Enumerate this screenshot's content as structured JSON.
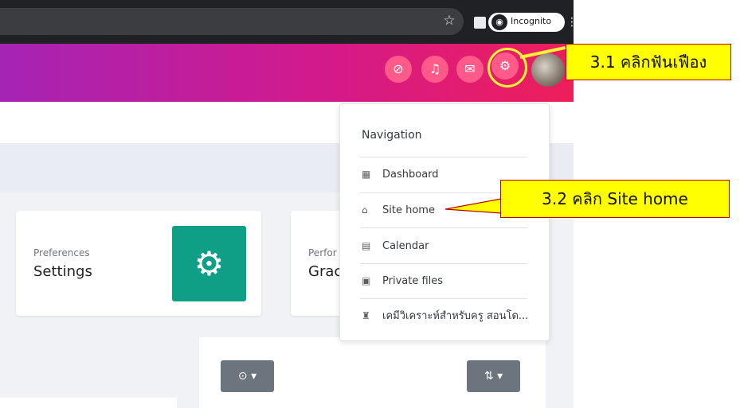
{
  "browser": {
    "incognito_label": "Incognito",
    "star_icon": "star-icon",
    "tab_icon": "sidepanel-icon"
  },
  "header": {
    "buttons": [
      "hide-icon",
      "bell-icon",
      "chat-icon",
      "gear-icon"
    ],
    "gradient_colors": [
      "#a524b4",
      "#d21a8c",
      "#ee1e5a"
    ]
  },
  "annotations": {
    "step1": "3.1 คลิกฟันเฟือง",
    "step2": "3.2 คลิก Site home",
    "highlight_color": "#ffff00",
    "border_color": "#c00000"
  },
  "cards": {
    "preferences": {
      "label": "Preferences",
      "title": "Settings",
      "tile_color": "#0f9f86"
    },
    "performance": {
      "label": "Perfor",
      "title": "Grac"
    }
  },
  "navigation": {
    "heading": "Navigation",
    "items": [
      {
        "icon": "dashboard-icon",
        "label": "Dashboard"
      },
      {
        "icon": "home-icon",
        "label": "Site home"
      },
      {
        "icon": "calendar-icon",
        "label": "Calendar"
      },
      {
        "icon": "file-icon",
        "label": "Private files"
      },
      {
        "icon": "graduation-cap-icon",
        "label": "เคมีวิเคราะห์สำหรับครู สอนโด..."
      }
    ]
  },
  "controls": {
    "clock_button": "⊙ ▾",
    "sort_button": "⇅ ▾"
  }
}
